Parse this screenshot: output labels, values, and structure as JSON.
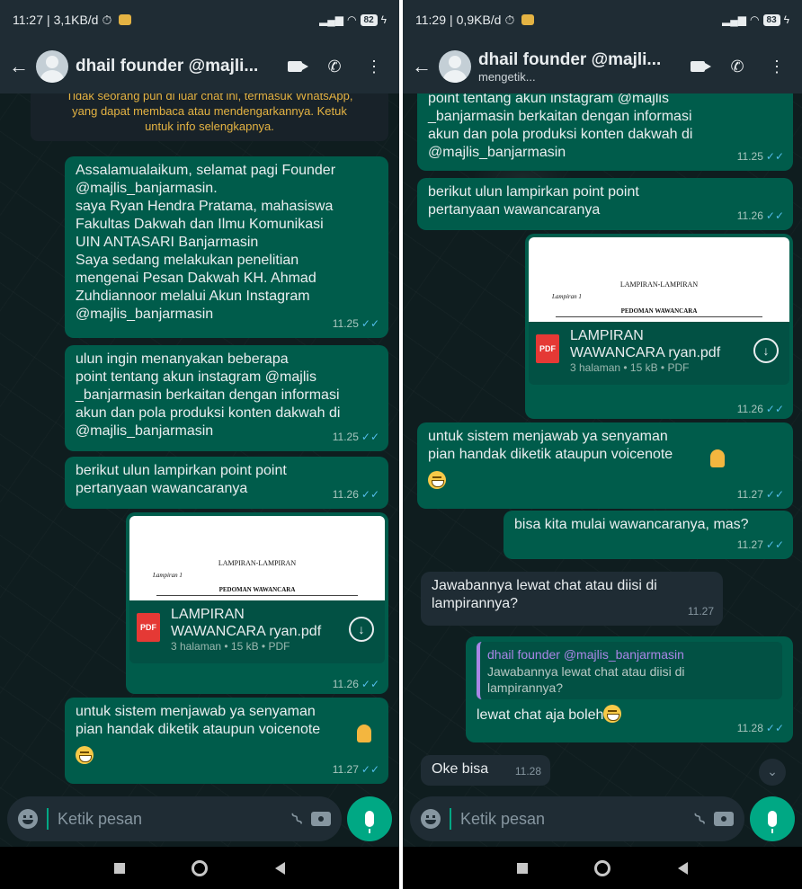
{
  "left": {
    "status": {
      "time": "11:27",
      "speed": "3,1KB/d",
      "battery": "82"
    },
    "contact": {
      "name": "dhail founder @majli...",
      "subtitle": ""
    },
    "system_note": "Tidak seorang pun di luar chat ini, termasuk WhatsApp,\nyang dapat membaca atau mendengarkannya. Ketuk\nuntuk info selengkapnya.",
    "messages": [
      {
        "text": "Assalamualaikum, selamat pagi Founder\n@majlis_banjarmasin.\nsaya Ryan Hendra Pratama, mahasiswa\nFakultas Dakwah dan Ilmu Komunikasi\nUIN ANTASARI Banjarmasin\nSaya sedang melakukan penelitian\nmengenai Pesan Dakwah KH. Ahmad\nZuhdiannoor melalui Akun Instagram\n@majlis_banjarmasin",
        "time": "11.25",
        "tick": "✓✓"
      },
      {
        "text": "ulun ingin menanyakan beberapa\npoint tentang akun instagram @majlis\n_banjarmasin berkaitan dengan informasi\nakun dan pola produksi konten dakwah di\n@majlis_banjarmasin",
        "time": "11.25",
        "tick": "✓✓"
      },
      {
        "text": "berikut ulun lampirkan point point\npertanyaan wawancaranya",
        "time": "11.26",
        "tick": "✓✓"
      },
      {
        "doc_name": "LAMPIRAN\nWAWANCARA ryan.pdf",
        "doc_meta": "3 halaman • 15 kB • PDF",
        "pdf_badge": "PDF",
        "thumb_title": "LAMPIRAN-LAMPIRAN",
        "thumb_sub": "Lampiran 1",
        "thumb_head": "PEDOMAN WAWANCARA",
        "time": "11.26",
        "tick": "✓✓"
      },
      {
        "text": "untuk sistem menjawab ya senyaman\npian handak diketik ataupun voicenote",
        "time": "11.27",
        "tick": "✓✓"
      }
    ],
    "input_placeholder": "Ketik pesan"
  },
  "right": {
    "status": {
      "time": "11:29",
      "speed": "0,9KB/d",
      "battery": "83"
    },
    "contact": {
      "name": "dhail founder @majli...",
      "subtitle": "mengetik..."
    },
    "messages": [
      {
        "text": "point tentang akun instagram @majlis\n_banjarmasin berkaitan dengan informasi\nakun dan pola produksi konten dakwah di\n@majlis_banjarmasin",
        "time": "11.25",
        "tick": "✓✓"
      },
      {
        "text": "berikut ulun lampirkan point point\npertanyaan wawancaranya",
        "time": "11.26",
        "tick": "✓✓"
      },
      {
        "doc_name": "LAMPIRAN\nWAWANCARA ryan.pdf",
        "doc_meta": "3 halaman • 15 kB • PDF",
        "pdf_badge": "PDF",
        "thumb_title": "LAMPIRAN-LAMPIRAN",
        "thumb_sub": "Lampiran 1",
        "thumb_head": "PEDOMAN WAWANCARA",
        "time": "11.26",
        "tick": "✓✓"
      },
      {
        "text": "untuk sistem menjawab ya senyaman\npian handak diketik ataupun voicenote",
        "time": "11.27",
        "tick": "✓✓"
      },
      {
        "text": "bisa kita mulai wawancaranya, mas?",
        "time": "11.27",
        "tick": "✓✓"
      },
      {
        "text": "Jawabannya lewat chat atau diisi di\nlampirannya?",
        "time": "11.27"
      },
      {
        "quote_name": "dhail founder @majlis_banjarmasin",
        "quote_text": "Jawabannya lewat chat atau diisi di\nlampirannya?",
        "text": "lewat chat aja boleh",
        "time": "11.28",
        "tick": "✓✓"
      },
      {
        "text": "Oke bisa",
        "time": "11.28"
      }
    ],
    "input_placeholder": "Ketik pesan"
  },
  "colors": {
    "outgoing": "#005c4b",
    "incoming": "#1f2c34",
    "header": "#1f2c34",
    "accent": "#00a884",
    "tick": "#53bdeb"
  },
  "icons": [
    "back-arrow-icon",
    "video-call-icon",
    "voice-call-icon",
    "more-icon",
    "emoji-icon",
    "attach-icon",
    "camera-icon",
    "mic-icon",
    "download-icon",
    "pdf-icon",
    "scroll-down-icon"
  ]
}
